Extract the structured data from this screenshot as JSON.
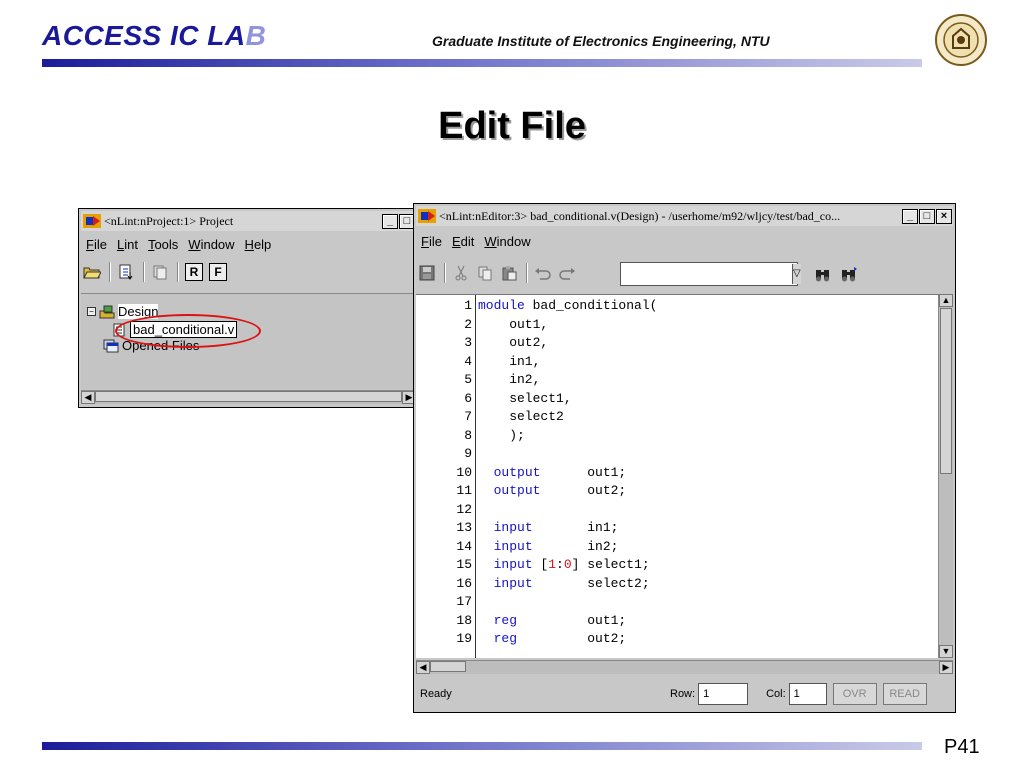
{
  "slide": {
    "logo_part1": "ACCESS IC LA",
    "logo_part2": "B",
    "institute": "Graduate Institute of Electronics Engineering, NTU",
    "title": "Edit File",
    "page": "P41",
    "colors": {
      "rule_dark": "#1c1c9a",
      "rule_light": "#c9cae8",
      "callout": "#dd1111"
    }
  },
  "project_window": {
    "title": "<nLint:nProject:1> Project",
    "controls": {
      "minimize": "_",
      "maximize": "□"
    },
    "menu": [
      "File",
      "Lint",
      "Tools",
      "Window",
      "Help"
    ],
    "toolbar": {
      "open_icon": "folder-open-icon",
      "import_icon": "import-icon",
      "copy_icon": "copy-icon",
      "r_label": "R",
      "f_label": "F"
    },
    "tree": {
      "design_label": "Design",
      "file_label": "bad_conditional.v",
      "opened_files_label": "Opened Files"
    }
  },
  "editor_window": {
    "title": "<nLint:nEditor:3> bad_conditional.v(Design) - /userhome/m92/wljcy/test/bad_co...",
    "controls": {
      "minimize": "_",
      "maximize": "□",
      "close": "×"
    },
    "menu": [
      "File",
      "Edit",
      "Window"
    ],
    "toolbar": {
      "save_icon": "save-icon",
      "cut_icon": "cut-icon",
      "copy_icon": "copy-icon",
      "paste_icon": "paste-icon",
      "undo_icon": "undo-icon",
      "redo_icon": "redo-icon",
      "find_icon": "binoculars-icon",
      "find_next_icon": "binoculars-next-icon",
      "search_value": ""
    },
    "code_lines": [
      {
        "n": "1",
        "parts": [
          {
            "t": "module",
            "c": "kw"
          },
          {
            "t": " bad_conditional(",
            "c": ""
          }
        ]
      },
      {
        "n": "2",
        "parts": [
          {
            "t": "    out1,",
            "c": ""
          }
        ]
      },
      {
        "n": "3",
        "parts": [
          {
            "t": "    out2,",
            "c": ""
          }
        ]
      },
      {
        "n": "4",
        "parts": [
          {
            "t": "    in1,",
            "c": ""
          }
        ]
      },
      {
        "n": "5",
        "parts": [
          {
            "t": "    in2,",
            "c": ""
          }
        ]
      },
      {
        "n": "6",
        "parts": [
          {
            "t": "    select1,",
            "c": ""
          }
        ]
      },
      {
        "n": "7",
        "parts": [
          {
            "t": "    select2",
            "c": ""
          }
        ]
      },
      {
        "n": "8",
        "parts": [
          {
            "t": "    );",
            "c": ""
          }
        ]
      },
      {
        "n": "9",
        "parts": []
      },
      {
        "n": "10",
        "parts": [
          {
            "t": "  ",
            "c": ""
          },
          {
            "t": "output",
            "c": "kw"
          },
          {
            "t": "      out1;",
            "c": ""
          }
        ]
      },
      {
        "n": "11",
        "parts": [
          {
            "t": "  ",
            "c": ""
          },
          {
            "t": "output",
            "c": "kw"
          },
          {
            "t": "      out2;",
            "c": ""
          }
        ]
      },
      {
        "n": "12",
        "parts": []
      },
      {
        "n": "13",
        "parts": [
          {
            "t": "  ",
            "c": ""
          },
          {
            "t": "input",
            "c": "kw"
          },
          {
            "t": "       in1;",
            "c": ""
          }
        ]
      },
      {
        "n": "14",
        "parts": [
          {
            "t": "  ",
            "c": ""
          },
          {
            "t": "input",
            "c": "kw"
          },
          {
            "t": "       in2;",
            "c": ""
          }
        ]
      },
      {
        "n": "15",
        "parts": [
          {
            "t": "  ",
            "c": ""
          },
          {
            "t": "input",
            "c": "kw"
          },
          {
            "t": " [",
            "c": ""
          },
          {
            "t": "1",
            "c": "num"
          },
          {
            "t": ":",
            "c": ""
          },
          {
            "t": "0",
            "c": "num"
          },
          {
            "t": "] select1;",
            "c": ""
          }
        ]
      },
      {
        "n": "16",
        "parts": [
          {
            "t": "  ",
            "c": ""
          },
          {
            "t": "input",
            "c": "kw"
          },
          {
            "t": "       select2;",
            "c": ""
          }
        ]
      },
      {
        "n": "17",
        "parts": []
      },
      {
        "n": "18",
        "parts": [
          {
            "t": "  ",
            "c": ""
          },
          {
            "t": "reg",
            "c": "kw"
          },
          {
            "t": "         out1;",
            "c": ""
          }
        ]
      },
      {
        "n": "19",
        "parts": [
          {
            "t": "  ",
            "c": ""
          },
          {
            "t": "reg",
            "c": "kw"
          },
          {
            "t": "         out2;",
            "c": ""
          }
        ]
      }
    ],
    "status": {
      "text": "Ready",
      "row_label": "Row:",
      "row_value": "1",
      "col_label": "Col:",
      "col_value": "1",
      "ovr": "OVR",
      "read": "READ"
    },
    "colors": {
      "keyword": "#1414c8",
      "number": "#d01818"
    }
  }
}
